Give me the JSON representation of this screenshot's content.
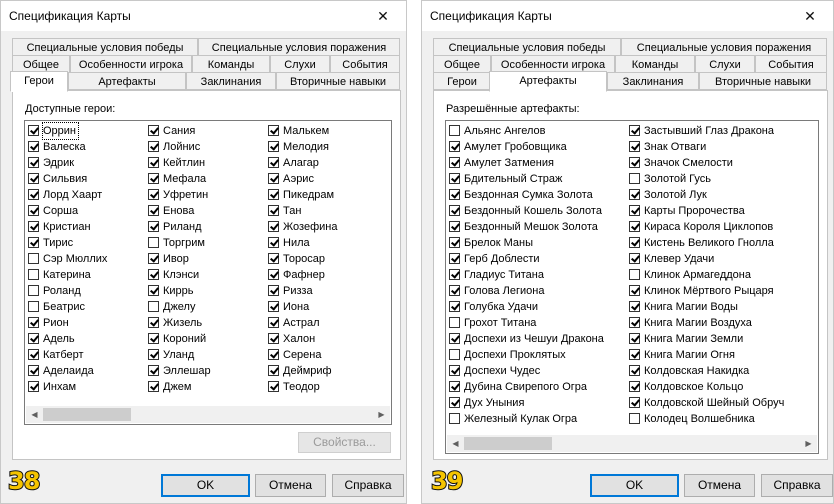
{
  "left_dialog": {
    "title": "Спецификация Карты",
    "close_glyph": "✕",
    "tabs_row1": [
      "Специальные условия победы",
      "Специальные условия поражения"
    ],
    "tabs_row2": [
      "Общее",
      "Особенности игрока",
      "Команды",
      "Слухи",
      "События"
    ],
    "tabs_row3": [
      "Герои",
      "Артефакты",
      "Заклинания",
      "Вторичные навыки"
    ],
    "active_tab": "Герои",
    "list_label": "Доступные герои:",
    "columns": [
      [
        {
          "text": "Оррин",
          "checked": true
        },
        {
          "text": "Валеска",
          "checked": true
        },
        {
          "text": "Эдрик",
          "checked": true
        },
        {
          "text": "Сильвия",
          "checked": true
        },
        {
          "text": "Лорд Хаарт",
          "checked": true
        },
        {
          "text": "Сорша",
          "checked": true
        },
        {
          "text": "Кристиан",
          "checked": true
        },
        {
          "text": "Тирис",
          "checked": true
        },
        {
          "text": "Сэр Мюллих",
          "checked": false
        },
        {
          "text": "Катерина",
          "checked": false
        },
        {
          "text": "Роланд",
          "checked": false
        },
        {
          "text": "Беатрис",
          "checked": false
        },
        {
          "text": "Рион",
          "checked": true
        },
        {
          "text": "Адель",
          "checked": true
        },
        {
          "text": "Катберт",
          "checked": true
        },
        {
          "text": "Аделаида",
          "checked": true
        },
        {
          "text": "Инхам",
          "checked": true
        }
      ],
      [
        {
          "text": "Сания",
          "checked": true
        },
        {
          "text": "Лойнис",
          "checked": true
        },
        {
          "text": "Кейтлин",
          "checked": true
        },
        {
          "text": "Мефала",
          "checked": true
        },
        {
          "text": "Уфретин",
          "checked": true
        },
        {
          "text": "Енова",
          "checked": true
        },
        {
          "text": "Риланд",
          "checked": true
        },
        {
          "text": "Торгрим",
          "checked": false
        },
        {
          "text": "Ивор",
          "checked": true
        },
        {
          "text": "Клэнси",
          "checked": true
        },
        {
          "text": "Киррь",
          "checked": true
        },
        {
          "text": "Джелу",
          "checked": false
        },
        {
          "text": "Жизель",
          "checked": true
        },
        {
          "text": "Короний",
          "checked": true
        },
        {
          "text": "Уланд",
          "checked": true
        },
        {
          "text": "Эллешар",
          "checked": true
        },
        {
          "text": "Джем",
          "checked": true
        }
      ],
      [
        {
          "text": "Малькем",
          "checked": true
        },
        {
          "text": "Мелодия",
          "checked": true
        },
        {
          "text": "Алагар",
          "checked": true
        },
        {
          "text": "Аэрис",
          "checked": true
        },
        {
          "text": "Пикедрам",
          "checked": true
        },
        {
          "text": "Тан",
          "checked": true
        },
        {
          "text": "Жозефина",
          "checked": true
        },
        {
          "text": "Нила",
          "checked": true
        },
        {
          "text": "Торосар",
          "checked": true
        },
        {
          "text": "Фафнер",
          "checked": true
        },
        {
          "text": "Ризза",
          "checked": true
        },
        {
          "text": "Иона",
          "checked": true
        },
        {
          "text": "Астрал",
          "checked": true
        },
        {
          "text": "Халон",
          "checked": true
        },
        {
          "text": "Серена",
          "checked": true
        },
        {
          "text": "Деймриф",
          "checked": true
        },
        {
          "text": "Теодор",
          "checked": true
        }
      ]
    ],
    "properties_button": "Свойства...",
    "ok": "OK",
    "cancel": "Отмена",
    "help": "Справка",
    "badge": "38"
  },
  "right_dialog": {
    "title": "Спецификация Карты",
    "close_glyph": "✕",
    "tabs_row1": [
      "Специальные условия победы",
      "Специальные условия поражения"
    ],
    "tabs_row2": [
      "Общее",
      "Особенности игрока",
      "Команды",
      "Слухи",
      "События"
    ],
    "tabs_row3": [
      "Герои",
      "Артефакты",
      "Заклинания",
      "Вторичные навыки"
    ],
    "active_tab": "Артефакты",
    "list_label": "Разрешённые артефакты:",
    "columns": [
      [
        {
          "text": "Альянс Ангелов",
          "checked": false
        },
        {
          "text": "Амулет Гробовщика",
          "checked": true
        },
        {
          "text": "Амулет Затмения",
          "checked": true
        },
        {
          "text": "Бдительный Страж",
          "checked": true
        },
        {
          "text": "Бездонная Сумка Золота",
          "checked": true
        },
        {
          "text": "Бездонный Кошель Золота",
          "checked": true
        },
        {
          "text": "Бездонный Мешок Золота",
          "checked": true
        },
        {
          "text": "Брелок Маны",
          "checked": true
        },
        {
          "text": "Герб Доблести",
          "checked": true
        },
        {
          "text": "Гладиус Титана",
          "checked": true
        },
        {
          "text": "Голова Легиона",
          "checked": true
        },
        {
          "text": "Голубка Удачи",
          "checked": true
        },
        {
          "text": "Грохот Титана",
          "checked": false
        },
        {
          "text": "Доспехи из Чешуи Дракона",
          "checked": true
        },
        {
          "text": "Доспехи Проклятых",
          "checked": false
        },
        {
          "text": "Доспехи Чудес",
          "checked": true
        },
        {
          "text": "Дубина Свирепого Огра",
          "checked": true
        },
        {
          "text": "Дух Уныния",
          "checked": true
        },
        {
          "text": "Железный Кулак Огра",
          "checked": false
        }
      ],
      [
        {
          "text": "Застывший Глаз Дракона",
          "checked": true
        },
        {
          "text": "Знак Отваги",
          "checked": true
        },
        {
          "text": "Значок Смелости",
          "checked": true
        },
        {
          "text": "Золотой Гусь",
          "checked": false
        },
        {
          "text": "Золотой Лук",
          "checked": true
        },
        {
          "text": "Карты Пророчества",
          "checked": true
        },
        {
          "text": "Кираса Короля Циклопов",
          "checked": true
        },
        {
          "text": "Кистень Великого Гнолла",
          "checked": true
        },
        {
          "text": "Клевер Удачи",
          "checked": true
        },
        {
          "text": "Клинок Армагеддона",
          "checked": false
        },
        {
          "text": "Клинок Мёртвого Рыцаря",
          "checked": true
        },
        {
          "text": "Книга Магии Воды",
          "checked": true
        },
        {
          "text": "Книга Магии Воздуха",
          "checked": true
        },
        {
          "text": "Книга Магии Земли",
          "checked": true
        },
        {
          "text": "Книга Магии Огня",
          "checked": true
        },
        {
          "text": "Колдовская Накидка",
          "checked": true
        },
        {
          "text": "Колдовское Кольцо",
          "checked": true
        },
        {
          "text": "Колдовской Шейный Обруч",
          "checked": true
        },
        {
          "text": "Колодец Волшебника",
          "checked": false
        }
      ]
    ],
    "ok": "OK",
    "cancel": "Отмена",
    "help": "Справка",
    "badge": "39"
  },
  "colors": {
    "accent": "#0078d7",
    "badge_fill": "#f5c400",
    "dialog_bg": "#f0f0f0"
  }
}
